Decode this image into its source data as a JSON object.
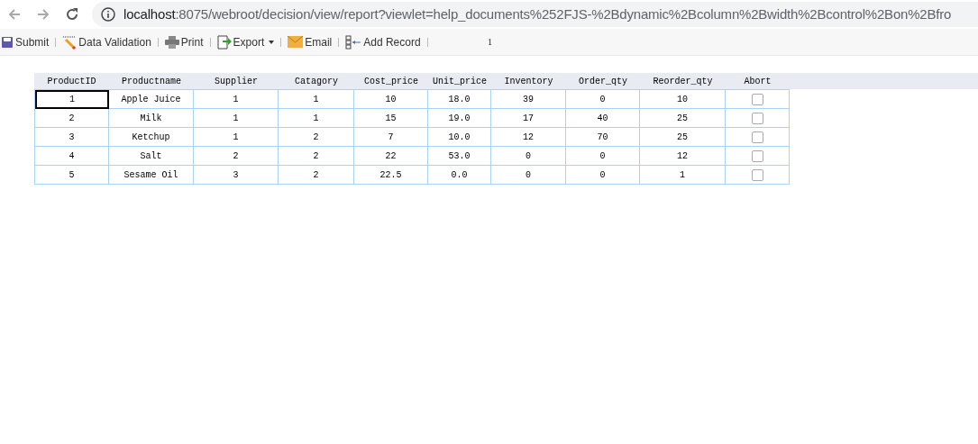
{
  "browser": {
    "url_host": "localhost",
    "url_rest": ":8075/webroot/decision/view/report?viewlet=help_documents%252FJS-%2Bdynamic%2Bcolumn%2Bwidth%2Bcontrol%2Bon%2Bfro"
  },
  "toolbar": {
    "items": [
      {
        "kind": "submit",
        "label": "Submit"
      },
      {
        "kind": "validate",
        "label": "Data Validation"
      },
      {
        "kind": "print",
        "label": "Print"
      },
      {
        "kind": "export",
        "label": "Export"
      },
      {
        "kind": "email",
        "label": "Email"
      },
      {
        "kind": "add",
        "label": "Add Record"
      }
    ],
    "page": "1"
  },
  "table": {
    "columns": [
      "ProductID",
      "Productname",
      "Supplier",
      "Catagory",
      "Cost_price",
      "Unit_price",
      "Inventory",
      "Order_qty",
      "Reorder_qty",
      "Abort"
    ],
    "rows": [
      {
        "cells": [
          "1",
          "Apple Juice",
          "1",
          "1",
          "10",
          "18.0",
          "39",
          "0",
          "10"
        ],
        "abort": false,
        "selected": true
      },
      {
        "cells": [
          "2",
          "Milk",
          "1",
          "1",
          "15",
          "19.0",
          "17",
          "40",
          "25"
        ],
        "abort": false,
        "selected": false
      },
      {
        "cells": [
          "3",
          "Ketchup",
          "1",
          "2",
          "7",
          "10.0",
          "12",
          "70",
          "25"
        ],
        "abort": false,
        "selected": false
      },
      {
        "cells": [
          "4",
          "Salt",
          "2",
          "2",
          "22",
          "53.0",
          "0",
          "0",
          "12"
        ],
        "abort": false,
        "selected": false
      },
      {
        "cells": [
          "5",
          "Sesame Oil",
          "3",
          "2",
          "22.5",
          "0.0",
          "0",
          "0",
          "1"
        ],
        "abort": false,
        "selected": false
      }
    ]
  }
}
